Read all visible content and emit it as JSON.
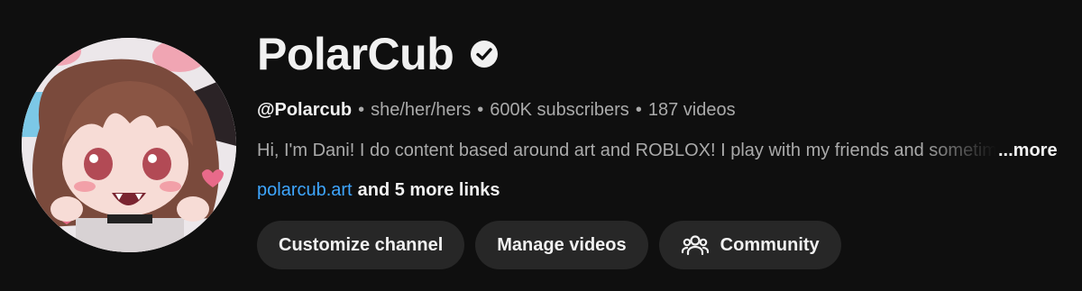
{
  "channel": {
    "name": "PolarCub",
    "verified_icon": "verified-check-icon",
    "handle": "@Polarcub",
    "pronouns": "she/her/hers",
    "subscribers": "600K subscribers",
    "videos": "187 videos",
    "separator": "•",
    "description": "Hi, I'm Dani! I do content based around art and ROBLOX! I play with my friends and sometimes",
    "more_label": "...more",
    "link_text": "polarcub.art",
    "more_links_label": "and 5 more links"
  },
  "buttons": {
    "customize": "Customize channel",
    "manage": "Manage videos",
    "community": "Community",
    "community_icon": "people-icon"
  },
  "colors": {
    "background": "#0f0f0f",
    "link": "#3ea6ff",
    "button_bg": "#272727",
    "muted_text": "#aaaaaa"
  }
}
